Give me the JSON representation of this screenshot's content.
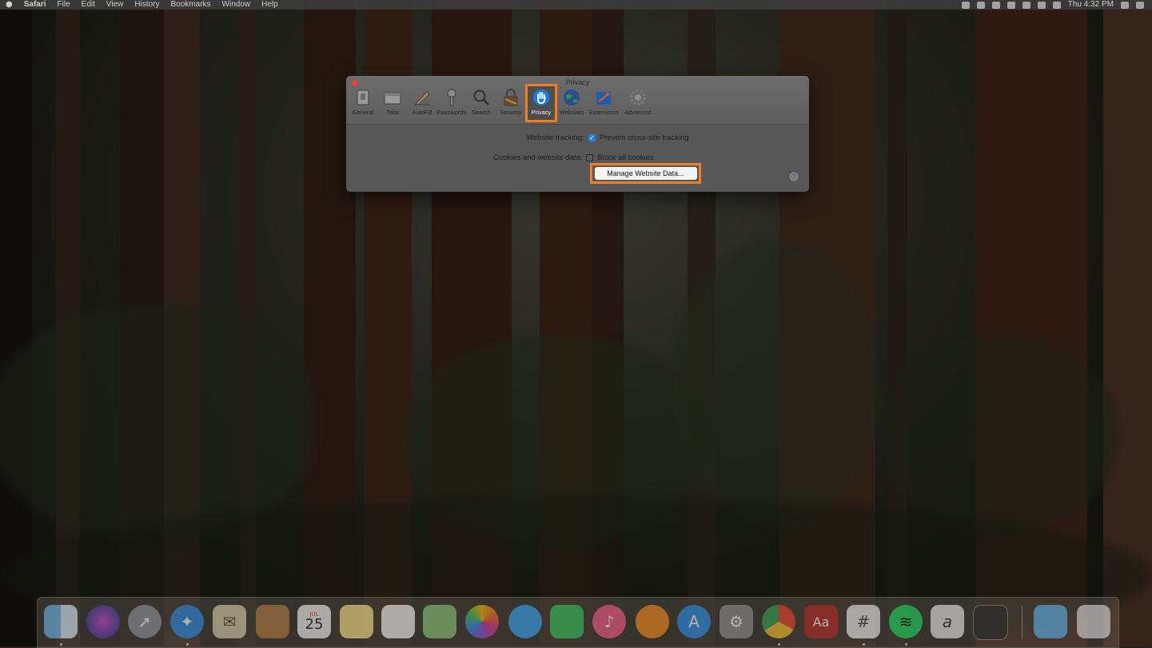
{
  "menubar": {
    "apple": "",
    "app_name": "Safari",
    "menus": [
      "File",
      "Edit",
      "View",
      "History",
      "Bookmarks",
      "Window",
      "Help"
    ],
    "clock": "Thu 4:32 PM"
  },
  "prefs": {
    "title": "Privacy",
    "tabs": [
      {
        "label": "General",
        "icon": "general-icon"
      },
      {
        "label": "Tabs",
        "icon": "tabs-icon"
      },
      {
        "label": "AutoFill",
        "icon": "autofill-icon"
      },
      {
        "label": "Passwords",
        "icon": "key-icon"
      },
      {
        "label": "Search",
        "icon": "magnifier-icon"
      },
      {
        "label": "Security",
        "icon": "lock-icon"
      },
      {
        "label": "Privacy",
        "icon": "hand-icon",
        "selected": true
      },
      {
        "label": "Websites",
        "icon": "globe-icon"
      },
      {
        "label": "Extensions",
        "icon": "puzzle-icon"
      },
      {
        "label": "Advanced",
        "icon": "gear-icon"
      }
    ],
    "website_tracking_label": "Website tracking:",
    "prevent_tracking_label": "Prevent cross-site tracking",
    "prevent_tracking_checked": true,
    "cookies_label": "Cookies and website data:",
    "block_cookies_label": "Block all cookies",
    "block_cookies_checked": false,
    "manage_button": "Manage Website Data...",
    "help": "?",
    "highlight_color": "#ef7f22"
  },
  "dock": {
    "calendar_month": "JUL",
    "calendar_day": "25",
    "dictionary_label": "Aa",
    "script_label": "a",
    "apps": [
      "Finder",
      "Siri",
      "Launchpad",
      "Safari",
      "Mail",
      "Contacts",
      "Calendar",
      "Notes",
      "Reminders",
      "Maps",
      "Photos",
      "Messages",
      "FaceTime",
      "iTunes",
      "iBooks",
      "App Store",
      "System Preferences",
      "Chrome",
      "Dictionary",
      "Slack",
      "Spotify",
      "Script Editor",
      "Activity Monitor",
      "Downloads",
      "Trash"
    ]
  }
}
